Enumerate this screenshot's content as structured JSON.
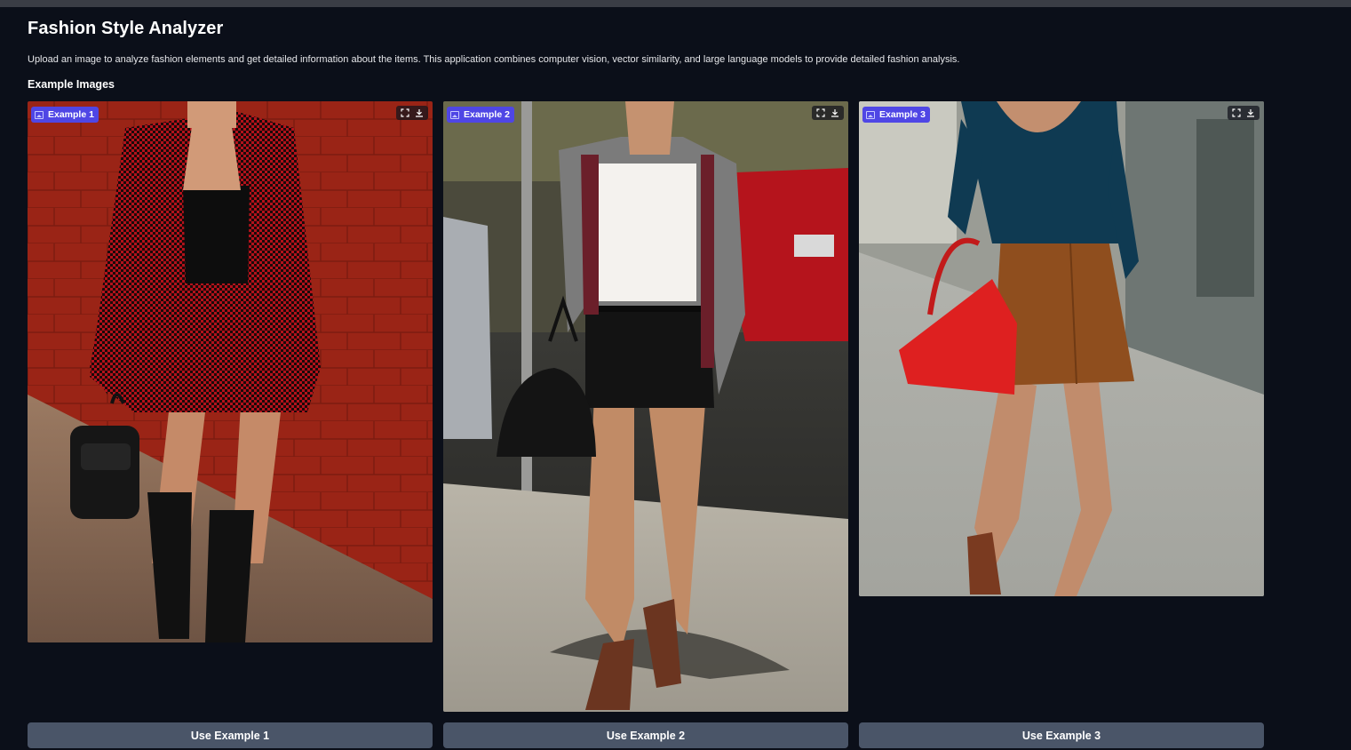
{
  "header": {
    "title": "Fashion Style Analyzer",
    "description": "Upload an image to analyze fashion elements and get detailed information about the items. This application combines computer vision, vector similarity, and large language models to provide detailed fashion analysis.",
    "examples_heading": "Example Images"
  },
  "examples": [
    {
      "label": "Example 1",
      "button_label": "Use Example 1",
      "icons": [
        "image-icon",
        "fullscreen-icon",
        "download-icon"
      ]
    },
    {
      "label": "Example 2",
      "button_label": "Use Example 2",
      "icons": [
        "image-icon",
        "fullscreen-icon",
        "download-icon"
      ]
    },
    {
      "label": "Example 3",
      "button_label": "Use Example 3",
      "icons": [
        "image-icon",
        "fullscreen-icon",
        "download-icon"
      ]
    }
  ],
  "colors": {
    "background": "#0b0f19",
    "badge": "#4f46e5",
    "button": "#4a5568"
  }
}
